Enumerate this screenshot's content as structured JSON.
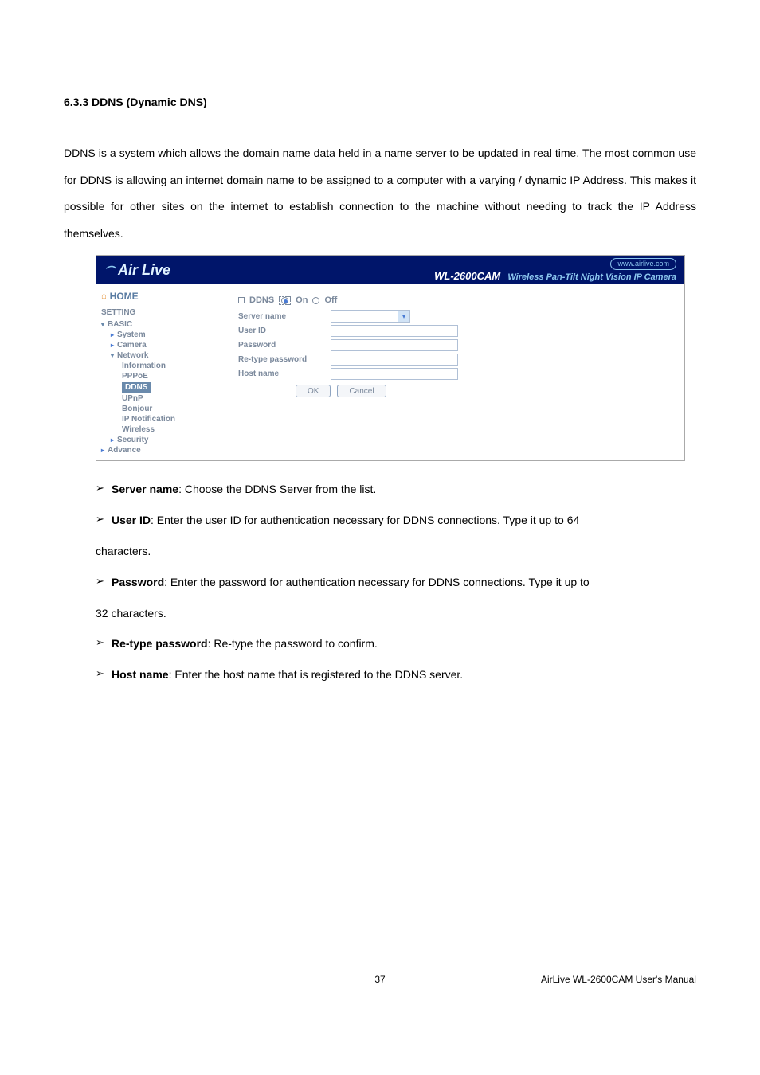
{
  "section": {
    "heading": "6.3.3 DDNS (Dynamic DNS)"
  },
  "intro": "DDNS is a system which allows the domain name data held in a name server to be updated in real time. The most common use for DDNS is allowing an internet domain name to be assigned to a computer with a varying / dynamic IP Address. This makes it possible for other sites on the internet to establish connection to the machine without needing to track the IP Address themselves.",
  "shot": {
    "logo": "Air Live",
    "url": "www.airlive.com",
    "model": "WL-2600CAM",
    "desc": "Wireless Pan-Tilt Night Vision IP Camera",
    "sidebar": {
      "home": "HOME",
      "setting": "SETTING",
      "basic": "BASIC",
      "system": "System",
      "camera": "Camera",
      "network": "Network",
      "information": "Information",
      "pppoe": "PPPoE",
      "ddns": "DDNS",
      "upnp": "UPnP",
      "bonjour": "Bonjour",
      "ipnotif": "IP Notification",
      "wireless": "Wireless",
      "security": "Security",
      "advance": "Advance"
    },
    "form": {
      "ddns_label": "DDNS",
      "on": "On",
      "off": "Off",
      "server_name": "Server name",
      "user_id": "User ID",
      "password": "Password",
      "retype": "Re-type password",
      "host_name": "Host name",
      "ok": "OK",
      "cancel": "Cancel"
    }
  },
  "bullets": {
    "arrow": "➢",
    "server_name_b": "Server name",
    "server_name_t": ": Choose the DDNS Server from the list.",
    "user_id_b": "User ID",
    "user_id_t": ": Enter the user ID for authentication necessary for DDNS connections. Type it up to 64",
    "user_id_c": "characters.",
    "password_b": "Password",
    "password_t": ": Enter the password for authentication necessary for DDNS connections. Type it up to",
    "password_c": "32 characters.",
    "retype_b": "Re-type password",
    "retype_t": ": Re-type the password to confirm.",
    "host_b": "Host name",
    "host_t": ": Enter the host name that is registered to the DDNS server."
  },
  "footer": {
    "page": "37",
    "right": "AirLive WL-2600CAM User's Manual"
  }
}
